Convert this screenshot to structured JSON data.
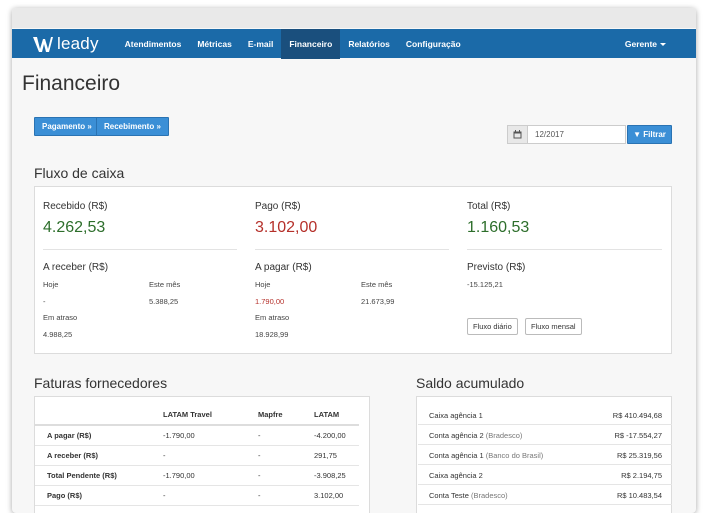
{
  "nav": {
    "brand": "leady",
    "items": [
      "Atendimentos",
      "Métricas",
      "E-mail",
      "Financeiro",
      "Relatórios",
      "Configuração"
    ],
    "active": "Financeiro",
    "user": "Gerente"
  },
  "page": {
    "title": "Financeiro"
  },
  "actions": {
    "pagamento": "Pagamento »",
    "recebimento": "Recebimento »",
    "date_value": "12/2017",
    "filter": "Filtrar"
  },
  "fluxo": {
    "title": "Fluxo de caixa",
    "recebido_label": "Recebido (R$)",
    "recebido_value": "4.262,53",
    "pago_label": "Pago (R$)",
    "pago_value": "3.102,00",
    "total_label": "Total (R$)",
    "total_value": "1.160,53",
    "a_receber_label": "A receber (R$)",
    "a_pagar_label": "A pagar (R$)",
    "previsto_label": "Previsto (R$)",
    "hoje": "Hoje",
    "este_mes": "Este mês",
    "em_atraso": "Em atraso",
    "receber_hoje": "-",
    "receber_mes": "5.388,25",
    "receber_atraso": "4.988,25",
    "pagar_hoje": "1.790,00",
    "pagar_mes": "21.673,99",
    "pagar_atraso": "18.928,99",
    "previsto_value": "-15.125,21",
    "fluxo_diario": "Fluxo diário",
    "fluxo_mensal": "Fluxo mensal"
  },
  "faturas": {
    "title": "Faturas fornecedores",
    "columns": [
      "",
      "LATAM Travel",
      "Mapfre",
      "LATAM"
    ],
    "rows": [
      [
        "A pagar (R$)",
        "-1.790,00",
        "-",
        "-4.200,00"
      ],
      [
        "A receber (R$)",
        "-",
        "-",
        "291,75"
      ],
      [
        "Total Pendente (R$)",
        "-1.790,00",
        "-",
        "-3.908,25"
      ],
      [
        "Pago (R$)",
        "-",
        "-",
        "3.102,00"
      ]
    ]
  },
  "saldo": {
    "title": "Saldo acumulado",
    "rows": [
      {
        "name": "Caixa agência 1",
        "sub": "",
        "value": "R$ 410.494,68"
      },
      {
        "name": "Conta agência 2",
        "sub": "(Bradesco)",
        "value": "R$ -17.554,27"
      },
      {
        "name": "Conta agência 1",
        "sub": "(Banco do Brasil)",
        "value": "R$ 25.319,56"
      },
      {
        "name": "Caixa agência 2",
        "sub": "",
        "value": "R$ 2.194,75"
      },
      {
        "name": "Conta Teste",
        "sub": "(Bradesco)",
        "value": "R$ 10.483,54"
      }
    ]
  },
  "colors": {
    "navbar": "#1b6aa8",
    "active_tab": "#1a4f7d",
    "button": "#3b8fd6",
    "positive": "#2d6e2b",
    "negative": "#b5302a"
  }
}
